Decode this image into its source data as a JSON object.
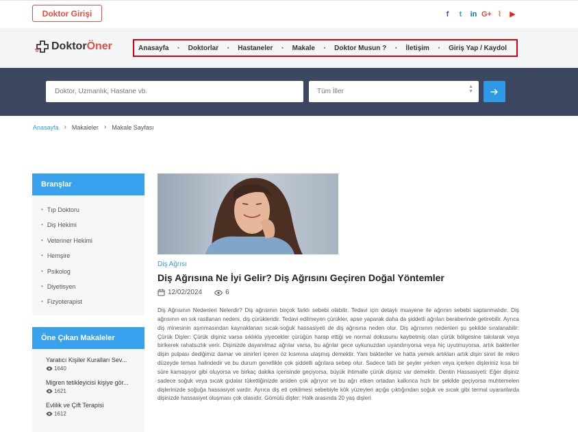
{
  "topbar": {
    "login_label": "Doktor Girişi",
    "social": [
      {
        "name": "facebook-icon",
        "glyph": "f"
      },
      {
        "name": "twitter-icon",
        "glyph": "t"
      },
      {
        "name": "linkedin-icon",
        "glyph": "in"
      },
      {
        "name": "google-plus-icon",
        "glyph": "G+"
      },
      {
        "name": "rss-icon",
        "glyph": "⌇"
      },
      {
        "name": "youtube-icon",
        "glyph": "▶"
      }
    ]
  },
  "header": {
    "logo_part1": "Doktor",
    "logo_part2": "Öner",
    "nav": [
      "Anasayfa",
      "Doktorlar",
      "Hastaneler",
      "Makale",
      "Doktor Musun ?",
      "İletişim",
      "Giriş Yap / Kaydol"
    ],
    "nav_separator": "•"
  },
  "search": {
    "placeholder": "Doktor, Uzmanlık, Hastane vb.",
    "select_value": "Tüm İller"
  },
  "breadcrumb": {
    "home": "Anasayfa",
    "items": [
      "Makaleler",
      "Makale Sayfası"
    ]
  },
  "sidebar": {
    "branches_title": "Branşlar",
    "branches": [
      "Tıp Doktoru",
      "Diş Hekimi",
      "Veteriner Hekimi",
      "Hemşire",
      "Psikolog",
      "Diyetisyen",
      "Fizyoterapist"
    ],
    "featured_title": "Öne Çıkan Makaleler",
    "featured": [
      {
        "title": "Yaratıcı Kişiler Kuralları Sev...",
        "views": "1640"
      },
      {
        "title": "Migren tetikleyicisi kişiye gör...",
        "views": "1621"
      },
      {
        "title": "Evlilik ve Çift Terapisi",
        "views": "1612"
      }
    ]
  },
  "article": {
    "category": "Diş Ağrısı",
    "title": "Diş Ağrısına Ne İyi Gelir? Diş Ağrısını Geçiren Doğal Yöntemler",
    "date": "12/02/2024",
    "views": "6",
    "body": "Diş Ağrısının Nedenleri Nelerdir? Diş ağrısının birçok farklı sebebi olabilir. Tedavi için detaylı muayene ile ağrının sebebi saptanmalıdır. Diş ağrısının en sık rastlanan nedeni, diş çürükleridir. Tedavi edilmeyen çürükler, apse yaparak daha da şiddetli ağrıları beraberinde getirebilir. Ayrıca diş minesinin aşınmasından kaynaklanan sıcak-soğuk hassasiyeti de diş ağrısına neden olur. Diş ağrısının nedenleri şu şekilde sıralanabilir: Çürük Dişler: Çürük dişiniz varsa sıklıkla yiyecekler çürüğün harap ettiği ve normal dokusunu kaybetmiş olan çürük bölgesine takılarak veya birikerek rahatsızlık verir. Dişinizde dayanılmaz ağrılar varsa, bu ağrılar gece uykunuzdan uyandırıyorsa veya hiç uyutmuyorsa, artık bakteriler dişin pulpası dediğimiz damar ve sinirleri içeren öz kısmına ulaşmış demektir. Yani bakteriler ve hatta yemek artıkları artık dişin siniri ile mikro düzeyde temas halindedir ve bu durum genellikle çok şiddetli ağrılara sebep olur. Sadece tatlı bir şeyler yerken veya içerken dişleriniz kısa bir süre kamaşıyor gibi oluyorsa ve birkaç dakika içerisinde geçiyorsa, büyük ihtimalle çürük dişiniz var demektir. Dentin Hassasiyeti: Eğer dişiniz sadece soğuk veya sıcak gıdalar tükettiğinizde aniden çok ağrıyor ve bu ağrı etken ortadan kalkınca hızlı bir şekilde geçiyorsa muhtemelen dişlerinizde soğuğa hassasiyet vardır. Ayrıca diş eti çekilmesi sebebiyle kök yüzeyleri açığa çıktığından soğuk ve sıcak gibi termal uyaranlarda dişinizde hassasiyet oluşması çok olasıdır. Gömülü dişler: Halk arasında 20 yaş dişleri"
  },
  "colors": {
    "accent": "#39a2ef",
    "brand_red": "#e74c3c",
    "search_bg": "#3d4660",
    "highlight_border": "#d9000d"
  }
}
